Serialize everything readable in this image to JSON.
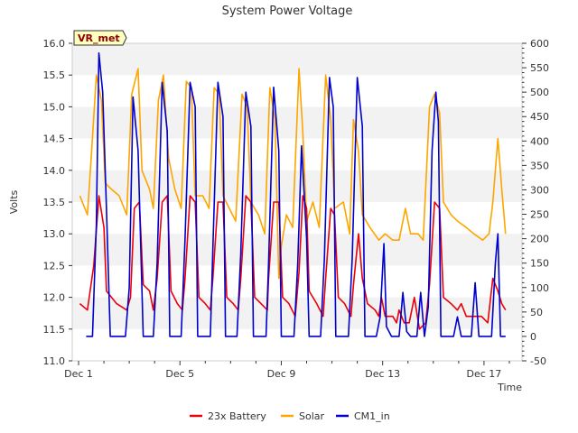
{
  "chart_data": {
    "type": "line",
    "title": "System Power Voltage",
    "xlabel": "Time",
    "ylabel": "Volts",
    "badge": "VR_met",
    "xlim": [
      0.75,
      18.5
    ],
    "ylim": [
      11.0,
      16.0
    ],
    "y2lim": [
      -50,
      600
    ],
    "x_ticks": [
      {
        "v": 1,
        "label": "Dec 1"
      },
      {
        "v": 5,
        "label": "Dec 5"
      },
      {
        "v": 9,
        "label": "Dec 9"
      },
      {
        "v": 13,
        "label": "Dec 13"
      },
      {
        "v": 17,
        "label": "Dec 17"
      }
    ],
    "y_ticks": [
      "11.0",
      "11.5",
      "12.0",
      "12.5",
      "13.0",
      "13.5",
      "14.0",
      "14.5",
      "15.0",
      "15.5",
      "16.0"
    ],
    "y2_ticks": [
      "-50",
      "0",
      "50",
      "100",
      "150",
      "200",
      "250",
      "300",
      "350",
      "400",
      "450",
      "500",
      "550",
      "600"
    ],
    "grid_bands": true,
    "legend_position": "bottom",
    "legend": [
      {
        "name": "23x Battery",
        "color": "#e8000b"
      },
      {
        "name": "Solar",
        "color": "#ffa500"
      },
      {
        "name": "CM1_in",
        "color": "#0000cc"
      }
    ],
    "series": [
      {
        "name": "23x Battery",
        "axis": "left",
        "color": "#e8000b",
        "points": [
          [
            1.05,
            11.9
          ],
          [
            1.35,
            11.8
          ],
          [
            1.6,
            12.5
          ],
          [
            1.8,
            13.6
          ],
          [
            2.0,
            13.1
          ],
          [
            2.1,
            12.1
          ],
          [
            2.5,
            11.9
          ],
          [
            2.9,
            11.8
          ],
          [
            3.05,
            12.0
          ],
          [
            3.2,
            13.4
          ],
          [
            3.4,
            13.5
          ],
          [
            3.55,
            12.2
          ],
          [
            3.8,
            12.1
          ],
          [
            3.95,
            11.8
          ],
          [
            4.1,
            12.3
          ],
          [
            4.3,
            13.5
          ],
          [
            4.5,
            13.6
          ],
          [
            4.65,
            12.1
          ],
          [
            4.9,
            11.9
          ],
          [
            5.1,
            11.8
          ],
          [
            5.2,
            12.3
          ],
          [
            5.4,
            13.6
          ],
          [
            5.6,
            13.5
          ],
          [
            5.75,
            12.0
          ],
          [
            6.0,
            11.9
          ],
          [
            6.2,
            11.8
          ],
          [
            6.3,
            12.3
          ],
          [
            6.5,
            13.5
          ],
          [
            6.7,
            13.5
          ],
          [
            6.85,
            12.0
          ],
          [
            7.1,
            11.9
          ],
          [
            7.3,
            11.8
          ],
          [
            7.4,
            12.3
          ],
          [
            7.6,
            13.6
          ],
          [
            7.8,
            13.5
          ],
          [
            7.95,
            12.0
          ],
          [
            8.2,
            11.9
          ],
          [
            8.45,
            11.8
          ],
          [
            8.5,
            12.3
          ],
          [
            8.7,
            13.5
          ],
          [
            8.9,
            13.5
          ],
          [
            9.05,
            12.0
          ],
          [
            9.3,
            11.9
          ],
          [
            9.55,
            11.7
          ],
          [
            9.7,
            12.4
          ],
          [
            9.85,
            13.6
          ],
          [
            10.0,
            13.4
          ],
          [
            10.1,
            12.1
          ],
          [
            10.4,
            11.9
          ],
          [
            10.65,
            11.7
          ],
          [
            10.75,
            12.3
          ],
          [
            10.95,
            13.4
          ],
          [
            11.1,
            13.3
          ],
          [
            11.25,
            12.0
          ],
          [
            11.5,
            11.9
          ],
          [
            11.75,
            11.7
          ],
          [
            11.85,
            12.2
          ],
          [
            12.05,
            13.0
          ],
          [
            12.2,
            12.3
          ],
          [
            12.4,
            11.9
          ],
          [
            12.7,
            11.8
          ],
          [
            12.85,
            11.7
          ],
          [
            12.95,
            12.0
          ],
          [
            13.1,
            11.7
          ],
          [
            13.4,
            11.7
          ],
          [
            13.55,
            11.6
          ],
          [
            13.65,
            11.8
          ],
          [
            13.85,
            11.6
          ],
          [
            14.05,
            11.6
          ],
          [
            14.25,
            12.0
          ],
          [
            14.45,
            11.5
          ],
          [
            14.7,
            11.6
          ],
          [
            14.85,
            12.2
          ],
          [
            15.05,
            13.5
          ],
          [
            15.25,
            13.4
          ],
          [
            15.4,
            12.0
          ],
          [
            15.7,
            11.9
          ],
          [
            15.95,
            11.8
          ],
          [
            16.1,
            11.9
          ],
          [
            16.3,
            11.7
          ],
          [
            16.6,
            11.7
          ],
          [
            16.9,
            11.7
          ],
          [
            17.15,
            11.6
          ],
          [
            17.35,
            12.3
          ],
          [
            17.55,
            12.1
          ],
          [
            17.7,
            11.9
          ],
          [
            17.85,
            11.8
          ]
        ]
      },
      {
        "name": "Solar",
        "axis": "left",
        "color": "#ffa500",
        "points": [
          [
            1.05,
            13.6
          ],
          [
            1.35,
            13.3
          ],
          [
            1.5,
            14.2
          ],
          [
            1.7,
            15.5
          ],
          [
            1.9,
            15.1
          ],
          [
            2.05,
            13.8
          ],
          [
            2.3,
            13.7
          ],
          [
            2.6,
            13.6
          ],
          [
            2.9,
            13.3
          ],
          [
            3.1,
            15.2
          ],
          [
            3.35,
            15.6
          ],
          [
            3.5,
            14.0
          ],
          [
            3.8,
            13.7
          ],
          [
            3.95,
            13.4
          ],
          [
            4.15,
            15.1
          ],
          [
            4.35,
            15.5
          ],
          [
            4.55,
            14.2
          ],
          [
            4.8,
            13.7
          ],
          [
            5.05,
            13.4
          ],
          [
            5.25,
            15.4
          ],
          [
            5.45,
            15.3
          ],
          [
            5.6,
            13.6
          ],
          [
            5.9,
            13.6
          ],
          [
            6.15,
            13.4
          ],
          [
            6.35,
            15.3
          ],
          [
            6.55,
            15.2
          ],
          [
            6.7,
            13.6
          ],
          [
            6.95,
            13.4
          ],
          [
            7.2,
            13.2
          ],
          [
            7.45,
            15.2
          ],
          [
            7.65,
            15.0
          ],
          [
            7.8,
            13.5
          ],
          [
            8.1,
            13.3
          ],
          [
            8.35,
            13.0
          ],
          [
            8.55,
            15.3
          ],
          [
            8.75,
            14.8
          ],
          [
            8.9,
            12.3
          ],
          [
            9.0,
            12.8
          ],
          [
            9.2,
            13.3
          ],
          [
            9.45,
            13.1
          ],
          [
            9.7,
            15.6
          ],
          [
            9.85,
            14.6
          ],
          [
            10.0,
            13.2
          ],
          [
            10.25,
            13.5
          ],
          [
            10.5,
            13.1
          ],
          [
            10.75,
            15.5
          ],
          [
            10.95,
            14.8
          ],
          [
            11.1,
            13.4
          ],
          [
            11.45,
            13.5
          ],
          [
            11.7,
            13.0
          ],
          [
            11.85,
            14.8
          ],
          [
            12.05,
            14.3
          ],
          [
            12.2,
            13.3
          ],
          [
            12.5,
            13.1
          ],
          [
            12.85,
            12.9
          ],
          [
            13.1,
            13.0
          ],
          [
            13.4,
            12.9
          ],
          [
            13.65,
            12.9
          ],
          [
            13.9,
            13.4
          ],
          [
            14.1,
            13.0
          ],
          [
            14.4,
            13.0
          ],
          [
            14.6,
            12.9
          ],
          [
            14.85,
            15.0
          ],
          [
            15.05,
            15.2
          ],
          [
            15.25,
            14.9
          ],
          [
            15.4,
            13.5
          ],
          [
            15.7,
            13.3
          ],
          [
            15.95,
            13.2
          ],
          [
            16.3,
            13.1
          ],
          [
            16.6,
            13.0
          ],
          [
            16.95,
            12.9
          ],
          [
            17.2,
            13.0
          ],
          [
            17.35,
            13.5
          ],
          [
            17.55,
            14.5
          ],
          [
            17.7,
            13.7
          ],
          [
            17.85,
            13.0
          ]
        ]
      },
      {
        "name": "CM1_in",
        "axis": "right",
        "color": "#0000cc",
        "points": [
          [
            1.3,
            0
          ],
          [
            1.55,
            0
          ],
          [
            1.7,
            230
          ],
          [
            1.8,
            580
          ],
          [
            1.95,
            500
          ],
          [
            2.1,
            260
          ],
          [
            2.25,
            0
          ],
          [
            2.85,
            0
          ],
          [
            3.0,
            100
          ],
          [
            3.15,
            490
          ],
          [
            3.35,
            380
          ],
          [
            3.55,
            0
          ],
          [
            3.95,
            0
          ],
          [
            4.1,
            150
          ],
          [
            4.3,
            520
          ],
          [
            4.5,
            420
          ],
          [
            4.6,
            0
          ],
          [
            5.05,
            0
          ],
          [
            5.2,
            200
          ],
          [
            5.4,
            520
          ],
          [
            5.6,
            470
          ],
          [
            5.7,
            0
          ],
          [
            6.2,
            0
          ],
          [
            6.3,
            180
          ],
          [
            6.5,
            520
          ],
          [
            6.7,
            450
          ],
          [
            6.8,
            0
          ],
          [
            7.25,
            0
          ],
          [
            7.4,
            170
          ],
          [
            7.6,
            500
          ],
          [
            7.8,
            430
          ],
          [
            7.9,
            0
          ],
          [
            8.4,
            0
          ],
          [
            8.5,
            150
          ],
          [
            8.7,
            510
          ],
          [
            8.9,
            380
          ],
          [
            9.0,
            0
          ],
          [
            9.5,
            0
          ],
          [
            9.65,
            150
          ],
          [
            9.8,
            390
          ],
          [
            10.0,
            200
          ],
          [
            10.1,
            0
          ],
          [
            10.55,
            0
          ],
          [
            10.7,
            160
          ],
          [
            10.9,
            530
          ],
          [
            11.05,
            470
          ],
          [
            11.15,
            0
          ],
          [
            11.65,
            0
          ],
          [
            11.8,
            160
          ],
          [
            12.0,
            530
          ],
          [
            12.2,
            430
          ],
          [
            12.3,
            0
          ],
          [
            12.75,
            0
          ],
          [
            12.9,
            40
          ],
          [
            13.05,
            190
          ],
          [
            13.15,
            20
          ],
          [
            13.35,
            0
          ],
          [
            13.65,
            0
          ],
          [
            13.8,
            90
          ],
          [
            13.95,
            10
          ],
          [
            14.1,
            0
          ],
          [
            14.35,
            0
          ],
          [
            14.5,
            90
          ],
          [
            14.65,
            0
          ],
          [
            14.8,
            60
          ],
          [
            14.95,
            380
          ],
          [
            15.1,
            500
          ],
          [
            15.2,
            440
          ],
          [
            15.3,
            0
          ],
          [
            15.8,
            0
          ],
          [
            15.95,
            40
          ],
          [
            16.1,
            0
          ],
          [
            16.5,
            0
          ],
          [
            16.65,
            110
          ],
          [
            16.8,
            0
          ],
          [
            17.3,
            0
          ],
          [
            17.45,
            150
          ],
          [
            17.55,
            210
          ],
          [
            17.65,
            0
          ],
          [
            17.85,
            0
          ]
        ]
      }
    ]
  }
}
